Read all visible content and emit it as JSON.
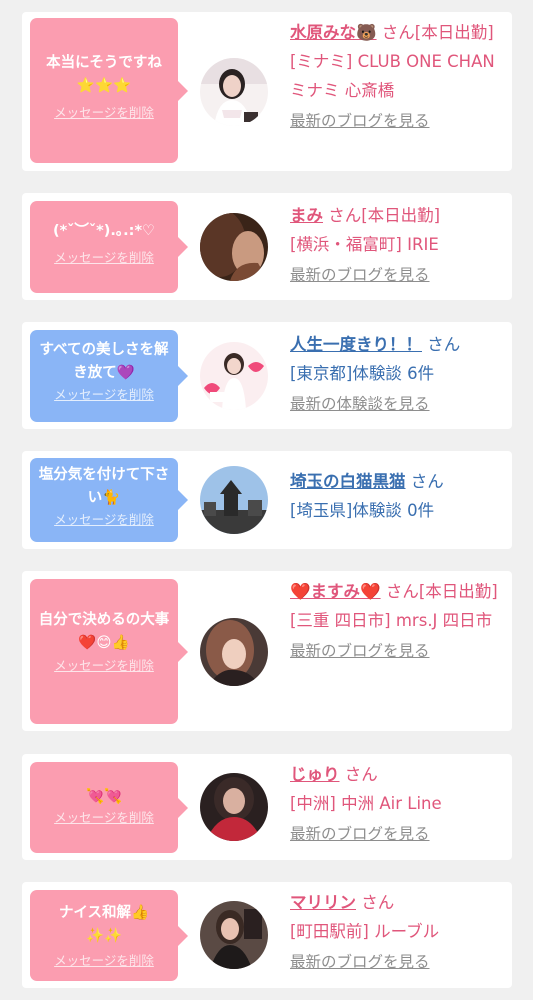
{
  "messages": [
    {
      "bubble_text": "本当にそうですね\n⭐⭐⭐",
      "delete_label": "メッセージを削除",
      "name": "水原みな🐻",
      "san": "さん[本日出勤]",
      "sub": "[ミナミ] CLUB ONE CHAN ミナミ 心斎橋",
      "link": "最新のブログを見る"
    },
    {
      "bubble_text": "(*ˇ︶ˇ*).｡.:*♡",
      "delete_label": "メッセージを削除",
      "name": "まみ",
      "san": "さん[本日出勤]",
      "sub": "[横浜・福富町] IRIE",
      "link": "最新のブログを見る"
    },
    {
      "bubble_text": "すべての美しさを解き放て💜",
      "delete_label": "メッセージを削除",
      "name": "人生一度きり！！",
      "san": "さん",
      "sub": "[東京都]体験談 6件",
      "link": "最新の体験談を見る"
    },
    {
      "bubble_text": "塩分気を付けて下さい🐈",
      "delete_label": "メッセージを削除",
      "name": "埼玉の白猫黒猫",
      "san": "さん",
      "sub": "[埼玉県]体験談 0件",
      "link": ""
    },
    {
      "bubble_text": "自分で決めるの大事❤️😊👍",
      "delete_label": "メッセージを削除",
      "name": "❤️ますみ❤️",
      "san": "さん[本日出勤]",
      "sub": "[三重 四日市] mrs.J 四日市",
      "link": "最新のブログを見る"
    },
    {
      "bubble_text": "💘💘",
      "delete_label": "メッセージを削除",
      "name": "じゅり",
      "san": "さん",
      "sub": "[中洲] 中洲 Air Line",
      "link": "最新のブログを見る"
    },
    {
      "bubble_text": "ナイス和解👍\n✨✨",
      "delete_label": "メッセージを削除",
      "name": "マリリン",
      "san": "さん",
      "sub": "[町田駅前] ルーブル",
      "link": "最新のブログを見る"
    }
  ],
  "colors": {
    "pink_bubble": "#fb9db0",
    "blue_bubble": "#8ab5f6",
    "pink_text": "#e0567b",
    "blue_text": "#3a6fb0",
    "link_gray": "#8e8e8e"
  }
}
